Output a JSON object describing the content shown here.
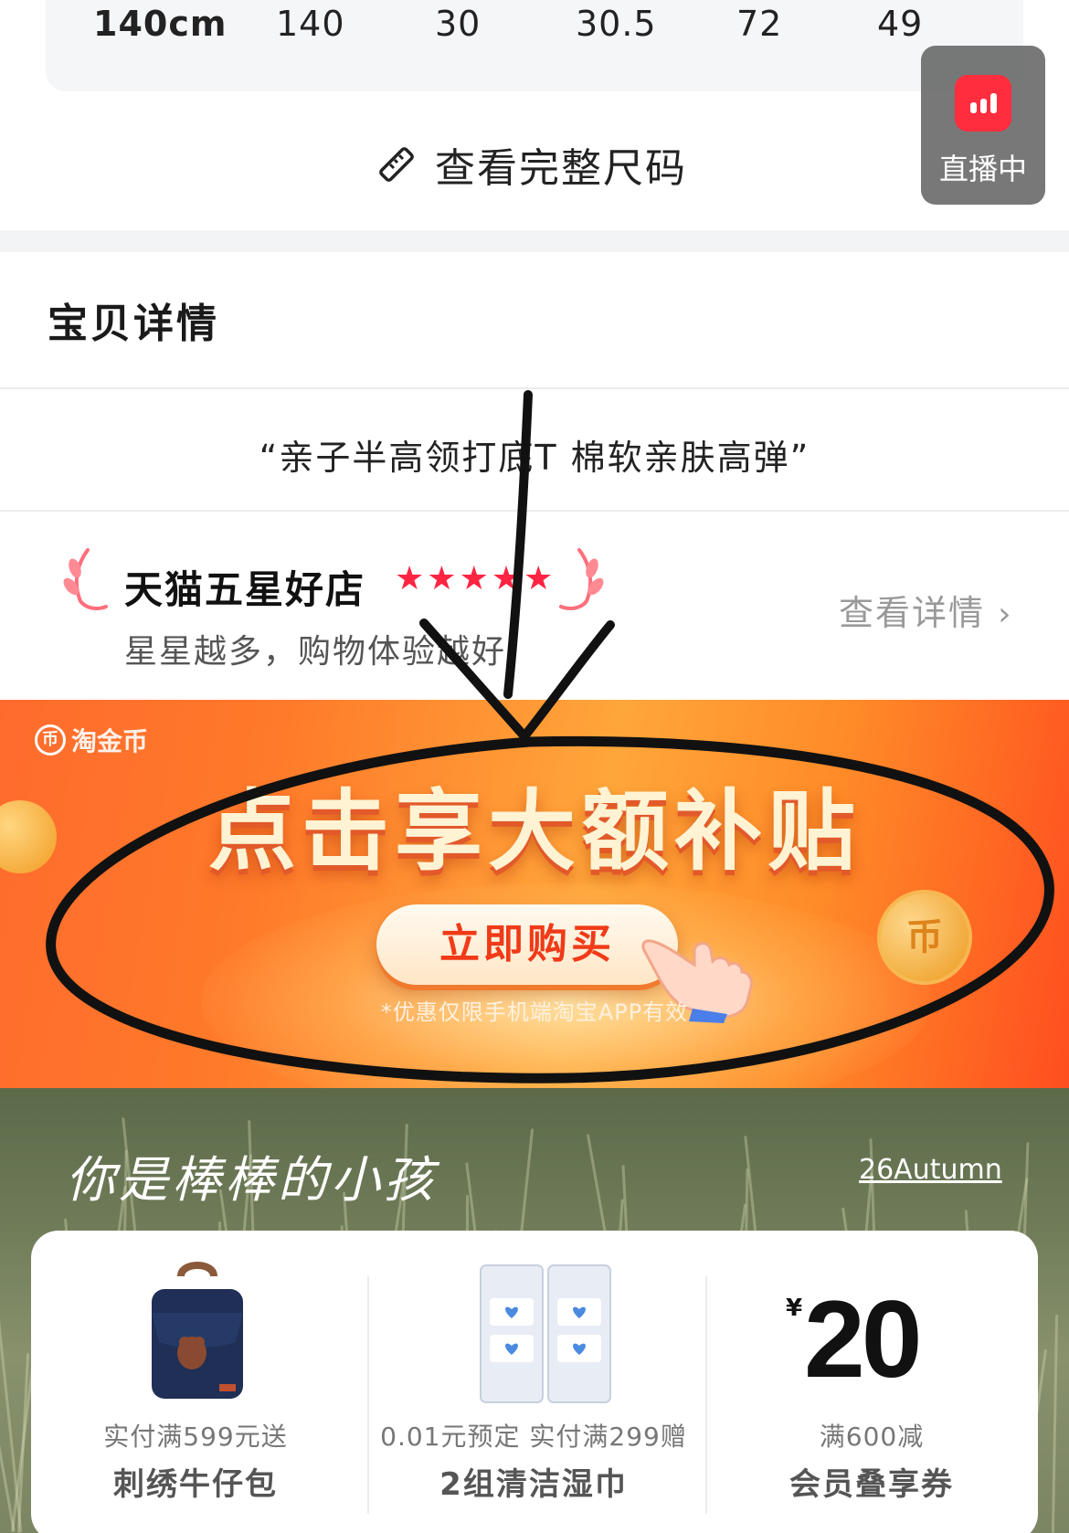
{
  "size_table": {
    "row": [
      "140cm",
      "140",
      "30",
      "30.5",
      "72",
      "49"
    ]
  },
  "full_size": {
    "label": "查看完整尺码",
    "icon": "ruler-icon"
  },
  "live": {
    "label": "直播中",
    "icon": "live-bars-icon"
  },
  "detail": {
    "heading": "宝贝详情"
  },
  "slogan": "“亲子半高领打底T 棉软亲肤高弹”",
  "store": {
    "title": "天猫五星好店",
    "stars": 5,
    "subtitle": "星星越多，购物体验越好",
    "link_label": "查看详情"
  },
  "banner": {
    "brand": "淘金币",
    "coin_glyph": "币",
    "headline": "点击享大额补贴",
    "button_label": "立即购买",
    "note": "*优惠仅限手机端淘宝APP有效"
  },
  "promo": {
    "slogan": "你是棒棒的小孩",
    "season": "26Autumn",
    "items": [
      {
        "line1": "实付满599元送",
        "line2": "刺绣牛仔包"
      },
      {
        "line1": "0.01元预定 实付满299赠",
        "line2": "2组清洁湿巾"
      },
      {
        "currency": "¥",
        "value": "20",
        "line1": "满600减",
        "line2": "会员叠享券"
      }
    ]
  },
  "colors": {
    "accent_red": "#ff2442",
    "live_red": "#ff2d3d",
    "banner_orange": "#ff7a2a",
    "button_text": "#f03a18"
  }
}
